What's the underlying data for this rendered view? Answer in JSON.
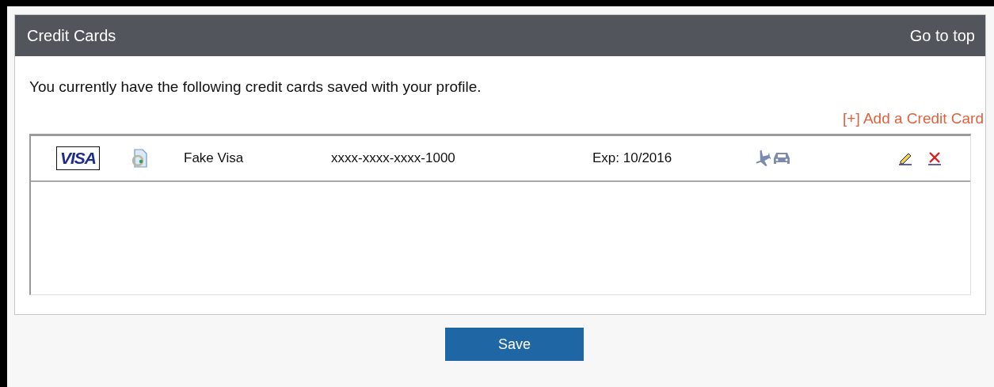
{
  "panel": {
    "title": "Credit Cards",
    "top_link": "Go to top"
  },
  "intro": "You currently have the following credit cards saved with your profile.",
  "add_link": "[+] Add a Credit Card",
  "cards": [
    {
      "brand": "VISA",
      "name": "Fake Visa",
      "number": "xxxx-xxxx-xxxx-1000",
      "expiry": "Exp: 10/2016"
    }
  ],
  "save_button": "Save"
}
